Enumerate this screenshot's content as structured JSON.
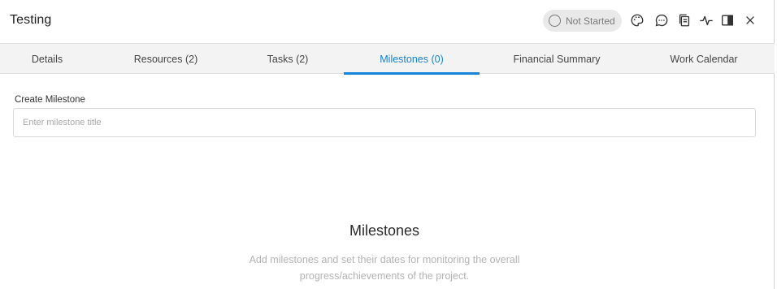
{
  "header": {
    "title": "Testing",
    "status": "Not Started",
    "icons": [
      "palette-icon",
      "comment-icon",
      "copy-icon",
      "activity-icon",
      "side-panel-icon",
      "close-icon"
    ]
  },
  "tabs": [
    {
      "label": "Details",
      "active": false
    },
    {
      "label": "Resources (2)",
      "active": false
    },
    {
      "label": "Tasks (2)",
      "active": false
    },
    {
      "label": "Milestones (0)",
      "active": true
    },
    {
      "label": "Financial Summary",
      "active": false
    },
    {
      "label": "Work Calendar",
      "active": false
    }
  ],
  "create_milestone": {
    "label": "Create Milestone",
    "placeholder": "Enter milestone title",
    "value": ""
  },
  "empty_state": {
    "title": "Milestones",
    "description_line1": "Add milestones and set their dates for monitoring the overall",
    "description_line2": "progress/achievements of the project."
  },
  "colors": {
    "accent": "#1683d8",
    "tab_bar": "#f3f3f3",
    "status_pill": "#e9e9e9"
  }
}
